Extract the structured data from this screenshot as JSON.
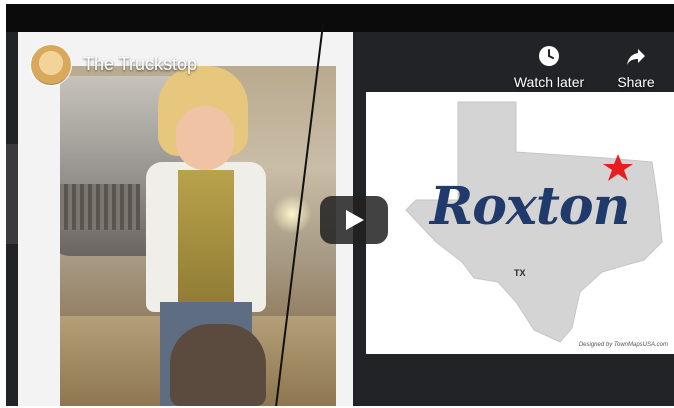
{
  "video": {
    "channel_title": "The Truckstop",
    "actions": [
      {
        "label": "Watch later",
        "icon": "clock-icon"
      },
      {
        "label": "Share",
        "icon": "share-arrow-icon"
      }
    ],
    "play_icon": "play-icon"
  },
  "thumbnail": {
    "map": {
      "city": "Roxton",
      "state": "TX",
      "credit": "Designed by TownMapsUSA.com"
    }
  },
  "colors": {
    "city_text": "#1f3a6b",
    "marker": "#e81d1d",
    "map_fill": "#d4d4d4"
  }
}
